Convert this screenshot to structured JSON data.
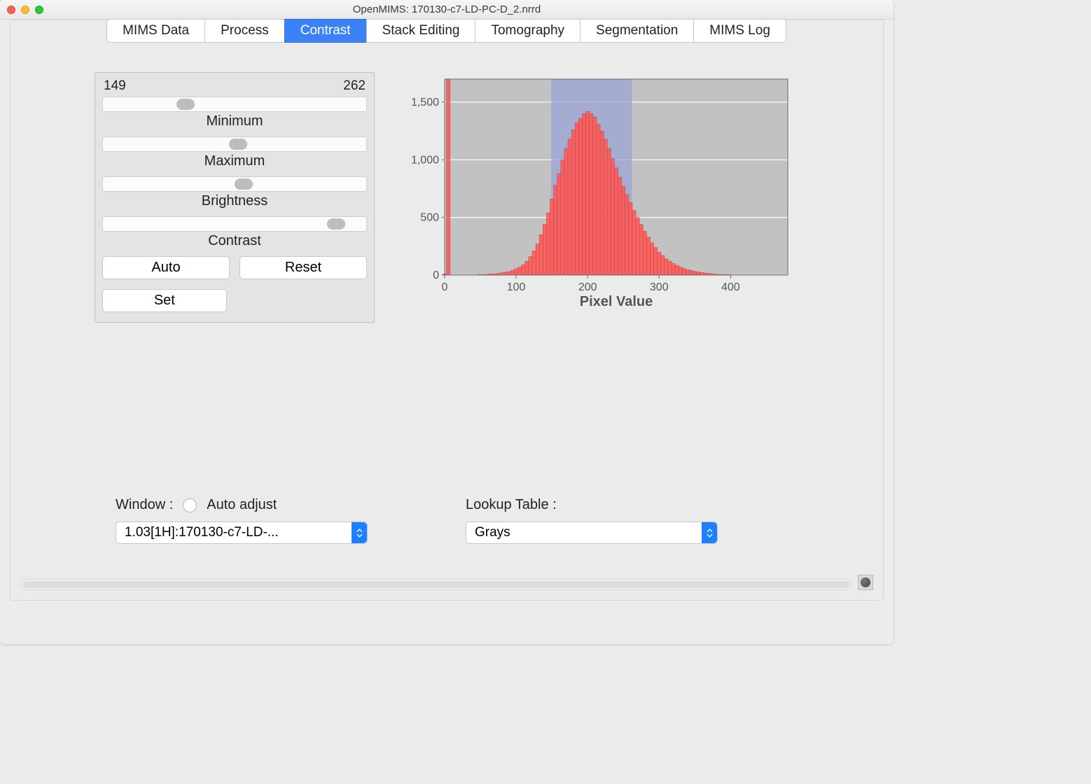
{
  "window_title": "OpenMIMS: 170130-c7-LD-PC-D_2.nrrd",
  "tabs": [
    "MIMS Data",
    "Process",
    "Contrast",
    "Stack Editing",
    "Tomography",
    "Segmentation",
    "MIMS Log"
  ],
  "active_tab_index": 2,
  "sliders": {
    "min_value_display": "149",
    "max_value_display": "262",
    "minimum_label": "Minimum",
    "maximum_label": "Maximum",
    "brightness_label": "Brightness",
    "contrast_label": "Contrast",
    "minimum_pos_pct": 28,
    "maximum_pos_pct": 48,
    "brightness_pos_pct": 50,
    "contrast_pos_pct": 85
  },
  "buttons": {
    "auto": "Auto",
    "reset": "Reset",
    "set": "Set"
  },
  "window_section": {
    "label": "Window :",
    "auto_adjust": "Auto adjust",
    "combo_value": "1.03[1H]:170130-c7-LD-..."
  },
  "lut_section": {
    "label": "Lookup Table :",
    "combo_value": "Grays"
  },
  "chart_data": {
    "type": "bar",
    "title": "",
    "xlabel": "Pixel Value",
    "ylabel": "",
    "xlim": [
      0,
      480
    ],
    "ylim": [
      0,
      1700
    ],
    "xticks": [
      0,
      100,
      200,
      300,
      400
    ],
    "yticks": [
      0,
      500,
      1000,
      1500
    ],
    "ytick_labels": [
      "0",
      "500",
      "1,000",
      "1,500"
    ],
    "highlight_band": {
      "from": 149,
      "to": 262,
      "color": "#9aa4d6"
    },
    "x": [
      0,
      5,
      10,
      15,
      20,
      25,
      30,
      35,
      40,
      45,
      50,
      55,
      60,
      65,
      70,
      75,
      80,
      85,
      90,
      95,
      100,
      105,
      110,
      115,
      120,
      125,
      130,
      135,
      140,
      145,
      150,
      155,
      160,
      165,
      170,
      175,
      180,
      185,
      190,
      195,
      200,
      205,
      210,
      215,
      220,
      225,
      230,
      235,
      240,
      245,
      250,
      255,
      260,
      265,
      270,
      275,
      280,
      285,
      290,
      295,
      300,
      305,
      310,
      315,
      320,
      325,
      330,
      335,
      340,
      345,
      350,
      355,
      360,
      365,
      370,
      375,
      380,
      385,
      390,
      395,
      400,
      410,
      420,
      430,
      440,
      450,
      460,
      470,
      480
    ],
    "values": [
      10,
      1700,
      0,
      0,
      0,
      0,
      0,
      0,
      0,
      0,
      5,
      5,
      8,
      10,
      12,
      15,
      20,
      25,
      30,
      40,
      55,
      70,
      90,
      120,
      160,
      210,
      270,
      350,
      440,
      540,
      660,
      780,
      880,
      1000,
      1100,
      1180,
      1260,
      1320,
      1360,
      1400,
      1420,
      1400,
      1370,
      1310,
      1250,
      1180,
      1100,
      1010,
      930,
      850,
      770,
      700,
      630,
      560,
      500,
      440,
      380,
      330,
      280,
      240,
      200,
      170,
      140,
      120,
      100,
      85,
      70,
      58,
      48,
      40,
      33,
      27,
      22,
      18,
      14,
      11,
      8,
      6,
      5,
      4,
      3,
      2,
      1,
      1,
      1,
      0,
      0,
      0,
      0
    ]
  }
}
